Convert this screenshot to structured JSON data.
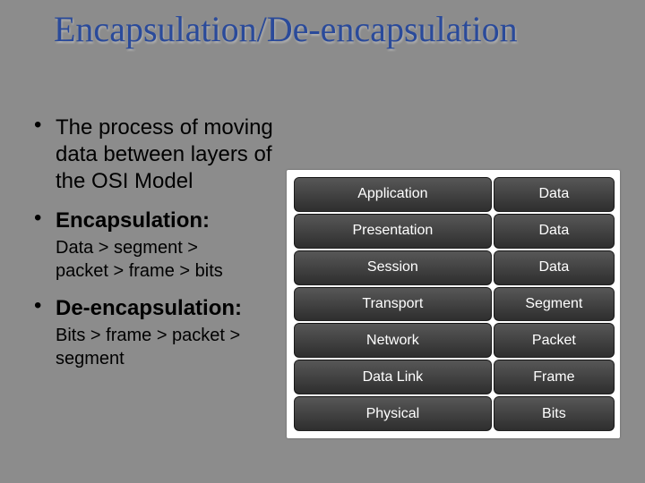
{
  "title": "Encapsulation/De-encapsulation",
  "bullets": {
    "b1": "The process of moving data between layers  of the OSI Model",
    "b2_head": "Encapsulation:",
    "b2_body": "Data > segment > packet > frame > bits",
    "b3_head": "De-encapsulation:",
    "b3_body": "Bits > frame > packet > segment"
  },
  "layers": [
    {
      "name": "Application",
      "pdu": "Data"
    },
    {
      "name": "Presentation",
      "pdu": "Data"
    },
    {
      "name": "Session",
      "pdu": "Data"
    },
    {
      "name": "Transport",
      "pdu": "Segment"
    },
    {
      "name": "Network",
      "pdu": "Packet"
    },
    {
      "name": "Data Link",
      "pdu": "Frame"
    },
    {
      "name": "Physical",
      "pdu": "Bits"
    }
  ]
}
